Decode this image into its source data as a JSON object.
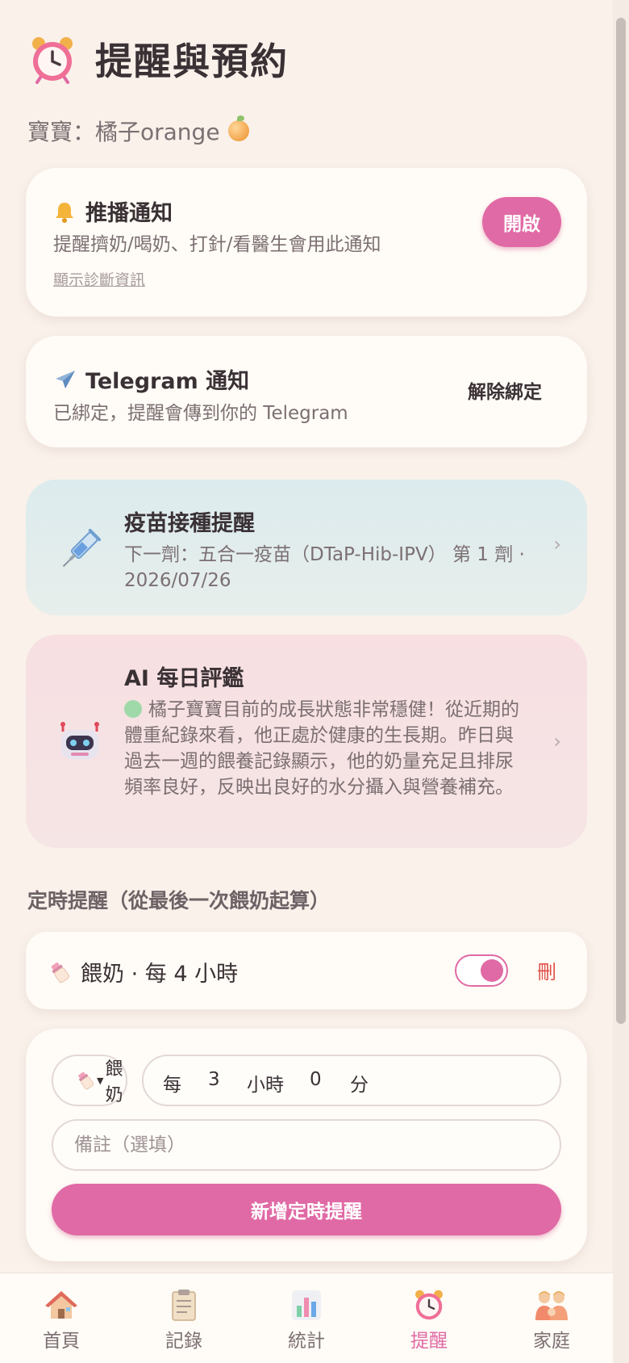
{
  "header": {
    "title": "提醒與預約"
  },
  "baby": {
    "label": "寶寶：橘子orange"
  },
  "push": {
    "title": "推播通知",
    "subtitle": "提醒擠奶/喝奶、打針/看醫生會用此通知",
    "diag_link": "顯示診斷資訊",
    "enable_label": "開啟"
  },
  "telegram": {
    "title": "Telegram 通知",
    "subtitle": "已綁定，提醒會傳到你的 Telegram",
    "unbind_label": "解除綁定"
  },
  "vaccine": {
    "title": "疫苗接種提醒",
    "text": "下一劑：五合一疫苗（DTaP-Hib-IPV） 第 1 劑 · 2026/07/26"
  },
  "ai": {
    "title": "AI 每日評鑑",
    "text": "橘子寶寶目前的成長狀態非常穩健！從近期的體重紀錄來看，他正處於健康的生長期。昨日與過去一週的餵養記錄顯示，他的奶量充足且排尿頻率良好，反映出良好的水分攝入與營養補充。"
  },
  "schedule": {
    "section_title": "定時提醒（從最後一次餵奶起算）",
    "items": [
      {
        "label": "餵奶 · 每 4 小時",
        "enabled": true,
        "delete_label": "刪"
      }
    ]
  },
  "form": {
    "type_label": "餵奶",
    "every_label": "每",
    "hours_value": "3",
    "hours_unit": "小時",
    "minutes_value": "0",
    "minutes_unit": "分",
    "note_placeholder": "備註（選填）",
    "submit_label": "新增定時提醒"
  },
  "nav": {
    "items": [
      {
        "label": "首頁",
        "icon": "home-icon"
      },
      {
        "label": "記錄",
        "icon": "clipboard-icon"
      },
      {
        "label": "統計",
        "icon": "bar-chart-icon"
      },
      {
        "label": "提醒",
        "icon": "alarm-clock-icon",
        "active": true
      },
      {
        "label": "家庭",
        "icon": "family-icon"
      }
    ]
  },
  "colors": {
    "accent": "#e06aa5",
    "background": "#f9f1ea",
    "card": "#fffbf6",
    "danger": "#e0504a"
  }
}
